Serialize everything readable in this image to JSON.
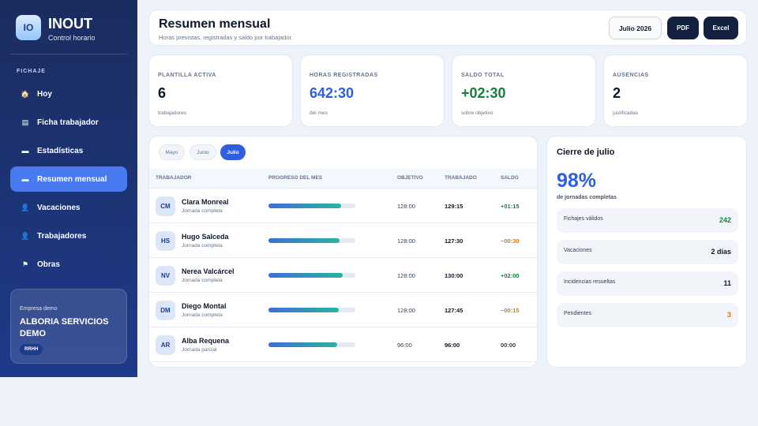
{
  "brand": {
    "logo_text": "IO",
    "name": "INOUT",
    "subtitle": "Control horario"
  },
  "sidebar": {
    "section_label": "FICHAJE",
    "items": [
      {
        "label": "Hoy",
        "icon": "home-icon",
        "glyph": "🏠",
        "active": false
      },
      {
        "label": "Ficha trabajador",
        "icon": "card-icon",
        "glyph": "▤",
        "active": false
      },
      {
        "label": "Estadísticas",
        "icon": "stats-icon",
        "glyph": "▬",
        "active": false
      },
      {
        "label": "Resumen mensual",
        "icon": "summary-icon",
        "glyph": "▬",
        "active": true
      },
      {
        "label": "Vacaciones",
        "icon": "user-icon",
        "glyph": "👤",
        "active": false
      },
      {
        "label": "Trabajadores",
        "icon": "users-icon",
        "glyph": "👤",
        "active": false
      },
      {
        "label": "Obras",
        "icon": "flag-icon",
        "glyph": "⚑",
        "active": false
      }
    ],
    "company": {
      "caption": "Empresa demo",
      "name": "ALBORIA SERVICIOS DEMO",
      "badge": "RRHH"
    }
  },
  "header": {
    "title": "Resumen mensual",
    "subtitle": "Horas previstas, registradas y saldo por trabajador.",
    "month_button": "Julio 2026",
    "pdf_button": "PDF",
    "excel_button": "Excel"
  },
  "kpis": [
    {
      "label": "PLANTILLA ACTIVA",
      "value": "6",
      "note": "trabajadores",
      "color": "#0f172a"
    },
    {
      "label": "HORAS REGISTRADAS",
      "value": "642:30",
      "note": "del mes",
      "color": "#2f5fe0"
    },
    {
      "label": "SALDO TOTAL",
      "value": "+02:30",
      "note": "sobre objetivo",
      "color": "#15803d"
    },
    {
      "label": "AUSENCIAS",
      "value": "2",
      "note": "justificadas",
      "color": "#0f172a"
    }
  ],
  "table": {
    "tabs": [
      {
        "label": "Mayo",
        "active": false
      },
      {
        "label": "Junio",
        "active": false
      },
      {
        "label": "Julio",
        "active": true
      }
    ],
    "columns": {
      "worker": "TRABAJADOR",
      "progress": "PROGRESO DEL MES",
      "target": "OBJETIVO",
      "worked": "TRABAJADO",
      "balance": "SALDO"
    },
    "rows": [
      {
        "initials": "CM",
        "name": "Clara Monreal",
        "type": "Jornada completa",
        "progress": 0.84,
        "target": "128:00",
        "worked": "129:15",
        "balance": "+01:15",
        "balance_color": "#15803d"
      },
      {
        "initials": "HS",
        "name": "Hugo Salceda",
        "type": "Jornada completa",
        "progress": 0.82,
        "target": "128:00",
        "worked": "127:30",
        "balance": "−00:30",
        "balance_color": "#d97706"
      },
      {
        "initials": "NV",
        "name": "Nerea Valcárcel",
        "type": "Jornada completa",
        "progress": 0.85,
        "target": "128:00",
        "worked": "130:00",
        "balance": "+02:00",
        "balance_color": "#15803d"
      },
      {
        "initials": "DM",
        "name": "Diego Montal",
        "type": "Jornada completa",
        "progress": 0.81,
        "target": "128:00",
        "worked": "127:45",
        "balance": "−00:15",
        "balance_color": "#d97706"
      },
      {
        "initials": "AR",
        "name": "Alba Requena",
        "type": "Jornada parcial",
        "progress": 0.79,
        "target": "96:00",
        "worked": "96:00",
        "balance": "00:00",
        "balance_color": "#334155"
      }
    ]
  },
  "closing": {
    "title": "Cierre de julio",
    "percent": "98%",
    "percent_caption": "de jornadas completas",
    "stats": [
      {
        "label": "Fichajes válidos",
        "value": "242",
        "color": "#15803d"
      },
      {
        "label": "Vacaciones",
        "value": "2 días",
        "color": "#0f172a"
      },
      {
        "label": "Incidencias resueltas",
        "value": "11",
        "color": "#0f172a"
      },
      {
        "label": "Pendientes",
        "value": "3",
        "color": "#d97706"
      }
    ]
  }
}
